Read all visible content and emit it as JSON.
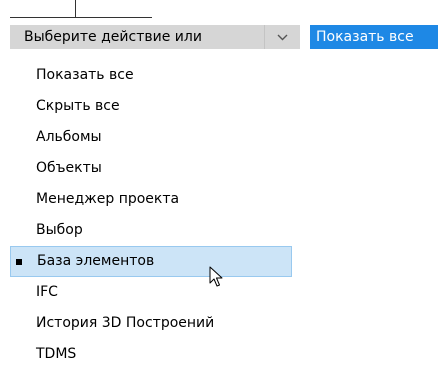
{
  "toolbar": {
    "action_select": {
      "value": "Выберите действие или",
      "dropdown_icon": "chevron-down-icon"
    },
    "show_all_button": "Показать все"
  },
  "menu": {
    "selected_index": 7,
    "items": [
      {
        "label": "Показать все"
      },
      {
        "label": "Скрыть все"
      },
      {
        "label": "Альбомы"
      },
      {
        "label": "Объекты"
      },
      {
        "label": "Менеджер проекта"
      },
      {
        "label": "Выбор"
      },
      {
        "label": "База элементов"
      },
      {
        "label": "IFC"
      },
      {
        "label": "История 3D Построений"
      },
      {
        "label": "TDMS"
      }
    ]
  },
  "colors": {
    "select_background": "#d6d6d6",
    "action_button": "#1e88e5",
    "highlight": "#cce4f7",
    "highlight_border": "#99c9ef"
  },
  "cursor_icon": "mouse-pointer-icon"
}
